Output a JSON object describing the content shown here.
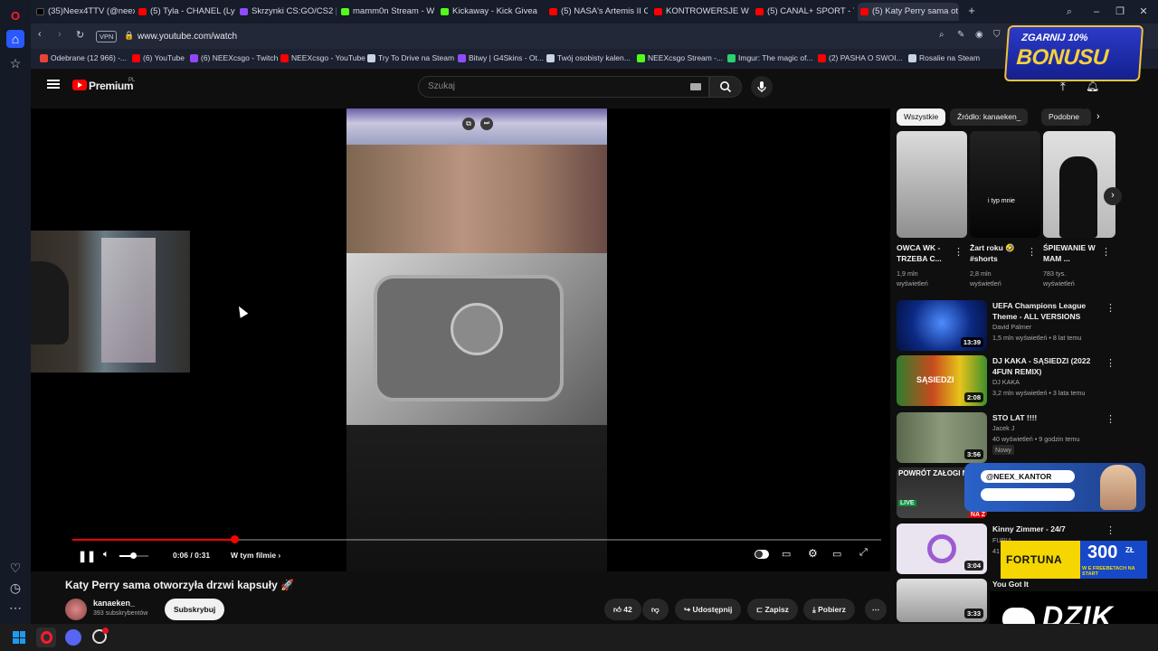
{
  "browser": {
    "tabs": [
      {
        "label": "(35)Neex4TTV (@neex4ttv",
        "color": "#000000"
      },
      {
        "label": "(5) Tyla - CHANEL (Lyr",
        "color": "#ff0000"
      },
      {
        "label": "Skrzynki CS:GO/CS2 | G4S",
        "color": "#8f4cff"
      },
      {
        "label": "mamm0n Stream - W",
        "color": "#53fc18"
      },
      {
        "label": "Kickaway - Kick Giveaway",
        "color": "#53fc18"
      },
      {
        "label": "(5) NASA's Artemis II Crew",
        "color": "#ff0000"
      },
      {
        "label": "KONTROWERSJE W KOŃC",
        "color": "#ff0000"
      },
      {
        "label": "(5) CANAL+ SPORT - YouT",
        "color": "#ff0000"
      },
      {
        "label": "(5) Katy Perry sama ot",
        "color": "#ff0000"
      }
    ],
    "vpn_label": "VPN",
    "url": "www.youtube.com/watch",
    "bookmarks": [
      {
        "label": "Odebrane (12 966) -...",
        "color": "#ea4335"
      },
      {
        "label": "(6) YouTube",
        "color": "#ff0000"
      },
      {
        "label": "(6) NEEXcsgo - Twitch",
        "color": "#9146ff"
      },
      {
        "label": "NEEXcsgo - YouTube",
        "color": "#ff0000"
      },
      {
        "label": "Try To Drive na Steam",
        "color": "#c7d5e0"
      },
      {
        "label": "Bitwy | G4Skins - Ot...",
        "color": "#8f4cff"
      },
      {
        "label": "Twój osobisty kalen...",
        "color": "#c7d5e0"
      },
      {
        "label": "NEEXcsgo Stream -...",
        "color": "#53fc18"
      },
      {
        "label": "Imgur: The magic of...",
        "color": "#2cd06e"
      },
      {
        "label": "(2) PASHA O SWOI...",
        "color": "#ff0000"
      },
      {
        "label": "Rosalie na Steam",
        "color": "#c7d5e0"
      }
    ]
  },
  "youtube": {
    "logo_text": "Premium",
    "logo_region": "PL",
    "search_placeholder": "Szukaj",
    "player": {
      "time": "0:06 / 0:31",
      "chapter": "W tym filmie",
      "progress": 0.2
    },
    "video": {
      "title": "Katy Perry sama otworzyła drzwi kapsuły 🚀",
      "channel": "kanaeken_",
      "subscribers": "393 subskrybentów",
      "subscribe_label": "Subskrybuj",
      "likes": "42",
      "share_label": "Udostępnij",
      "save_label": "Zapisz",
      "download_label": "Pobierz"
    },
    "chips": [
      "Wszystkie",
      "Źródło: kanaeken_",
      "Podobne"
    ],
    "shorts": [
      {
        "title": "OWCA WK - TRZEBA C...",
        "views": "1,9 mln wyświetleń"
      },
      {
        "title": "Żart roku 🤣 #shorts",
        "views": "2,8 mln wyświetleń",
        "overlay": "i typ mnie"
      },
      {
        "title": "ŚPIEWANIE W MAM ...",
        "views": "783 tys. wyświetleń"
      }
    ],
    "recommendations": [
      {
        "title": "UEFA Champions League Theme - ALL VERSIONS",
        "channel": "David Palmer",
        "meta": "1,5 mln wyświetleń • 8 lat temu",
        "duration": "13:39"
      },
      {
        "title": "DJ KAKA - SĄSIEDZI (2022 4FUN REMIX)",
        "channel": "DJ KAKA",
        "meta": "3,2 mln wyświetleń • 3 lata temu",
        "duration": "2:08",
        "overlay": "SĄSIEDZI"
      },
      {
        "title": "STO LAT !!!!",
        "channel": "Jacek J",
        "meta": "40 wyświetleń • 9 godzin temu",
        "badge": "Nowy",
        "duration": "3:56"
      },
      {
        "title": "",
        "channel": "",
        "meta": "",
        "overlay": "POWRÓT ZAŁOGI NA",
        "live": "LIVE",
        "live_sub": "NA Ż"
      },
      {
        "title": "Kinny Zimmer - 24/7",
        "channel": "FURIA",
        "meta": "41",
        "duration": "3:04"
      },
      {
        "title": "You Got It",
        "channel": "",
        "meta": "",
        "duration": "3:33"
      }
    ]
  },
  "overlays": {
    "bonus_top": "ZGARNIJ 10%",
    "bonus_main": "BONUSU",
    "instagram": "@NEEX_KANTOR",
    "fortuna": "FORTUNA",
    "fortuna_amount": "300",
    "fortuna_currency": "ZŁ",
    "fortuna_sub": "W E FREEBETACH NA START",
    "dzik": "DZIK"
  }
}
